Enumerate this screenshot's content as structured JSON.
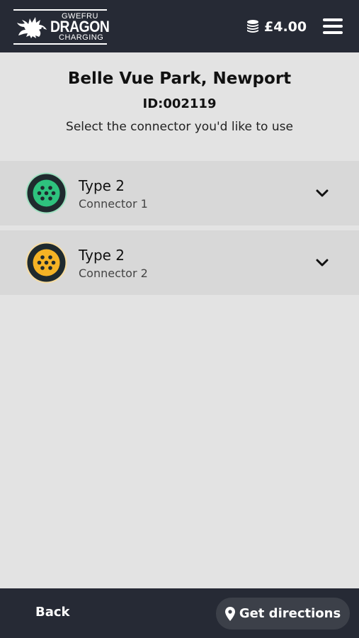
{
  "brand": {
    "line_top": "GWEFRU",
    "line_main": "DRAGON",
    "line_bottom": "CHARGING"
  },
  "header_bar": {
    "balance": "£4.00",
    "balance_icon": "coins-icon",
    "menu_icon": "hamburger-menu-icon"
  },
  "site": {
    "name": "Belle Vue Park, Newport",
    "id": "ID:002119",
    "instruction": "Select the connector you'd like to use"
  },
  "connectors": [
    {
      "type": "Type 2",
      "label": "Connector 1",
      "status_color": "#2ec27e",
      "icon": "type2-plug-icon"
    },
    {
      "type": "Type 2",
      "label": "Connector 2",
      "status_color": "#f5b325",
      "icon": "type2-plug-icon"
    }
  ],
  "footer": {
    "back_label": "Back",
    "directions_label": "Get directions",
    "directions_icon": "map-pin-icon"
  },
  "colors": {
    "bar": "#262a35",
    "background": "#e3e3e3",
    "row": "#d8d8d8",
    "available": "#2ec27e",
    "charging": "#f5b325"
  }
}
